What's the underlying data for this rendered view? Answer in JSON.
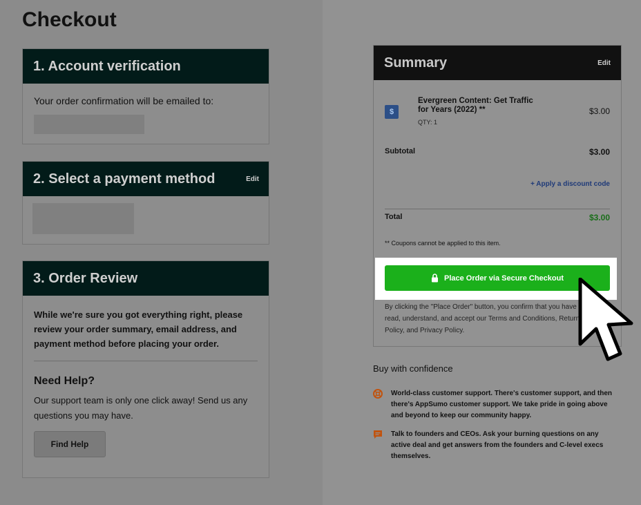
{
  "page": {
    "title": "Checkout"
  },
  "account": {
    "title": "1. Account verification",
    "email_label": "Your order confirmation will be emailed to:"
  },
  "payment": {
    "title": "2. Select a payment method",
    "edit_label": "Edit"
  },
  "review": {
    "title": "3. Order Review",
    "text": "While we're sure you got everything right, please review your order summary, email address, and payment method before placing your order.",
    "help_title": "Need Help?",
    "help_text": "Our support team is only one click away! Send us any questions you may have.",
    "find_help_label": "Find Help"
  },
  "summary": {
    "title": "Summary",
    "edit_label": "Edit",
    "product": {
      "name": "Evergreen Content: Get Traffic for Years (2022) **",
      "qty": "QTY: 1",
      "price": "$3.00",
      "icon": "product-thumbnail"
    },
    "subtotal_label": "Subtotal",
    "subtotal_value": "$3.00",
    "discount_link": "+ Apply a discount code",
    "total_label": "Total",
    "total_value": "$3.00",
    "coupon_note": "** Coupons cannot be applied to this item.",
    "place_order_label": "Place Order via Secure Checkout",
    "legal_text": "By clicking the \"Place Order\" button, you confirm that you have read, understand, and accept our Terms and Conditions, Return Policy, and Privacy Policy.",
    "total_color": "#1a6e1a"
  },
  "confidence": {
    "title": "Buy with confidence",
    "items": [
      {
        "icon": "lifebuoy-icon",
        "text": "World-class customer support. There's customer support, and then there's AppSumo customer support. We take pride in going above and beyond to keep our community happy."
      },
      {
        "icon": "chat-icon",
        "text": "Talk to founders and CEOs. Ask your burning questions on any active deal and get answers from the founders and C-level execs themselves."
      }
    ]
  },
  "colors": {
    "place_order_green": "#1bb01b",
    "panel_header": "#021b19",
    "summary_header": "#111111",
    "icon_orange": "#c1530e"
  }
}
